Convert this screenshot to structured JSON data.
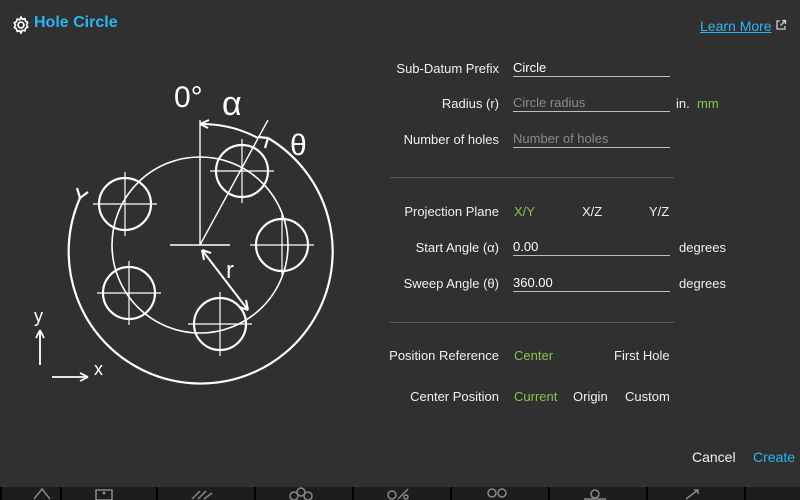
{
  "dialog": {
    "title": "Hole Circle",
    "title_icon": "gear-icon",
    "learn_more": "Learn More",
    "learn_more_icon": "external-link-icon"
  },
  "diagram": {
    "angle_zero": "0°",
    "alpha": "α",
    "theta": "θ",
    "radius": "r",
    "x_axis": "x",
    "y_axis": "y"
  },
  "form": {
    "prefix": {
      "label": "Sub-Datum Prefix",
      "value": "Circle"
    },
    "radius": {
      "label": "Radius (r)",
      "placeholder": "Circle radius",
      "units": [
        "in.",
        "mm"
      ],
      "selected_unit": "mm"
    },
    "holes": {
      "label": "Number of holes",
      "placeholder": "Number of holes"
    },
    "plane": {
      "label": "Projection Plane",
      "options": [
        "X/Y",
        "X/Z",
        "Y/Z"
      ],
      "selected": "X/Y"
    },
    "start_angle": {
      "label": "Start Angle (α)",
      "value": "0.00",
      "unit": "degrees"
    },
    "sweep_angle": {
      "label": "Sweep Angle (θ)",
      "value": "360.00",
      "unit": "degrees"
    },
    "position_reference": {
      "label": "Position Reference",
      "options": [
        "Center",
        "First Hole"
      ],
      "selected": "Center"
    },
    "center_position": {
      "label": "Center Position",
      "options": [
        "Current",
        "Origin",
        "Custom"
      ],
      "selected": "Current"
    }
  },
  "buttons": {
    "cancel": "Cancel",
    "create": "Create"
  },
  "colors": {
    "accent": "#29b6f6",
    "selected": "#8bc34a",
    "background": "#303030"
  }
}
